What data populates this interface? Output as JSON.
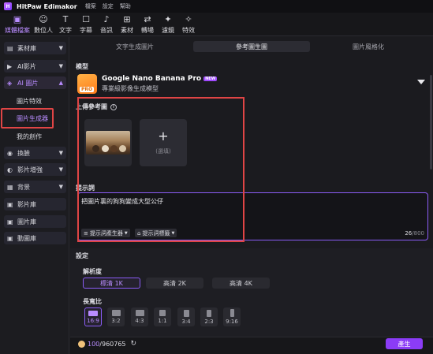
{
  "titlebar": {
    "app_name": "HitPaw Edimakor",
    "menu_file": "檔案",
    "menu_settings": "設定",
    "menu_help": "幫助"
  },
  "toolbar": {
    "items": [
      {
        "label": "媒體檔案",
        "icon": "media-icon"
      },
      {
        "label": "數位人",
        "icon": "avatar-icon"
      },
      {
        "label": "文字",
        "icon": "text-icon"
      },
      {
        "label": "字幕",
        "icon": "subtitle-icon"
      },
      {
        "label": "音訊",
        "icon": "audio-icon"
      },
      {
        "label": "素材",
        "icon": "material-icon"
      },
      {
        "label": "轉場",
        "icon": "transition-icon"
      },
      {
        "label": "濾鏡",
        "icon": "filter-icon"
      },
      {
        "label": "特效",
        "icon": "effects-icon"
      }
    ],
    "active": "媒體檔案"
  },
  "sidebar": {
    "items": [
      {
        "label": "素材庫"
      },
      {
        "label": "AI影片"
      },
      {
        "label": "AI 圖片"
      },
      {
        "label": "圖片特效"
      },
      {
        "label": "圖片生成器"
      },
      {
        "label": "我的創作"
      },
      {
        "label": "換臉"
      },
      {
        "label": "影片增強"
      },
      {
        "label": "背景"
      },
      {
        "label": "影片庫"
      },
      {
        "label": "圖片庫"
      },
      {
        "label": "動圖庫"
      }
    ]
  },
  "tabs": [
    {
      "label": "文字生成圖片"
    },
    {
      "label": "參考圖生圖"
    },
    {
      "label": "圖片風格化"
    }
  ],
  "model": {
    "section_label": "模型",
    "name": "Google Nano Banana Pro",
    "badge": "NEW",
    "pro_label": "PRO",
    "description": "專業級影像生成模型"
  },
  "upload": {
    "title": "上傳參考圖",
    "optional_label": "(選填)"
  },
  "prompt": {
    "title": "提示詞",
    "text": "把圖片裏的狗狗變成大型公仔",
    "generator_label": "提示詞產生器",
    "tags_label": "提示詞標籤",
    "count_current": "26",
    "count_max": "/800"
  },
  "settings": {
    "title": "設定",
    "resolution_title": "解析度",
    "resolutions": [
      {
        "label": "標清 1K"
      },
      {
        "label": "高清 2K"
      },
      {
        "label": "高清 4K"
      }
    ],
    "resolution_active": "標清 1K",
    "aspect_title": "長寬比",
    "aspects": [
      {
        "label": "16:9"
      },
      {
        "label": "3:2"
      },
      {
        "label": "4:3"
      },
      {
        "label": "1:1"
      },
      {
        "label": "3:4"
      },
      {
        "label": "2:3"
      },
      {
        "label": "9:16"
      }
    ],
    "aspect_active": "16:9"
  },
  "footer": {
    "credits_used": "100",
    "credits_total": "/960765",
    "generate_label": "產生"
  },
  "colors": {
    "accent": "#8b5cf6",
    "highlight_box": "#e04545"
  }
}
